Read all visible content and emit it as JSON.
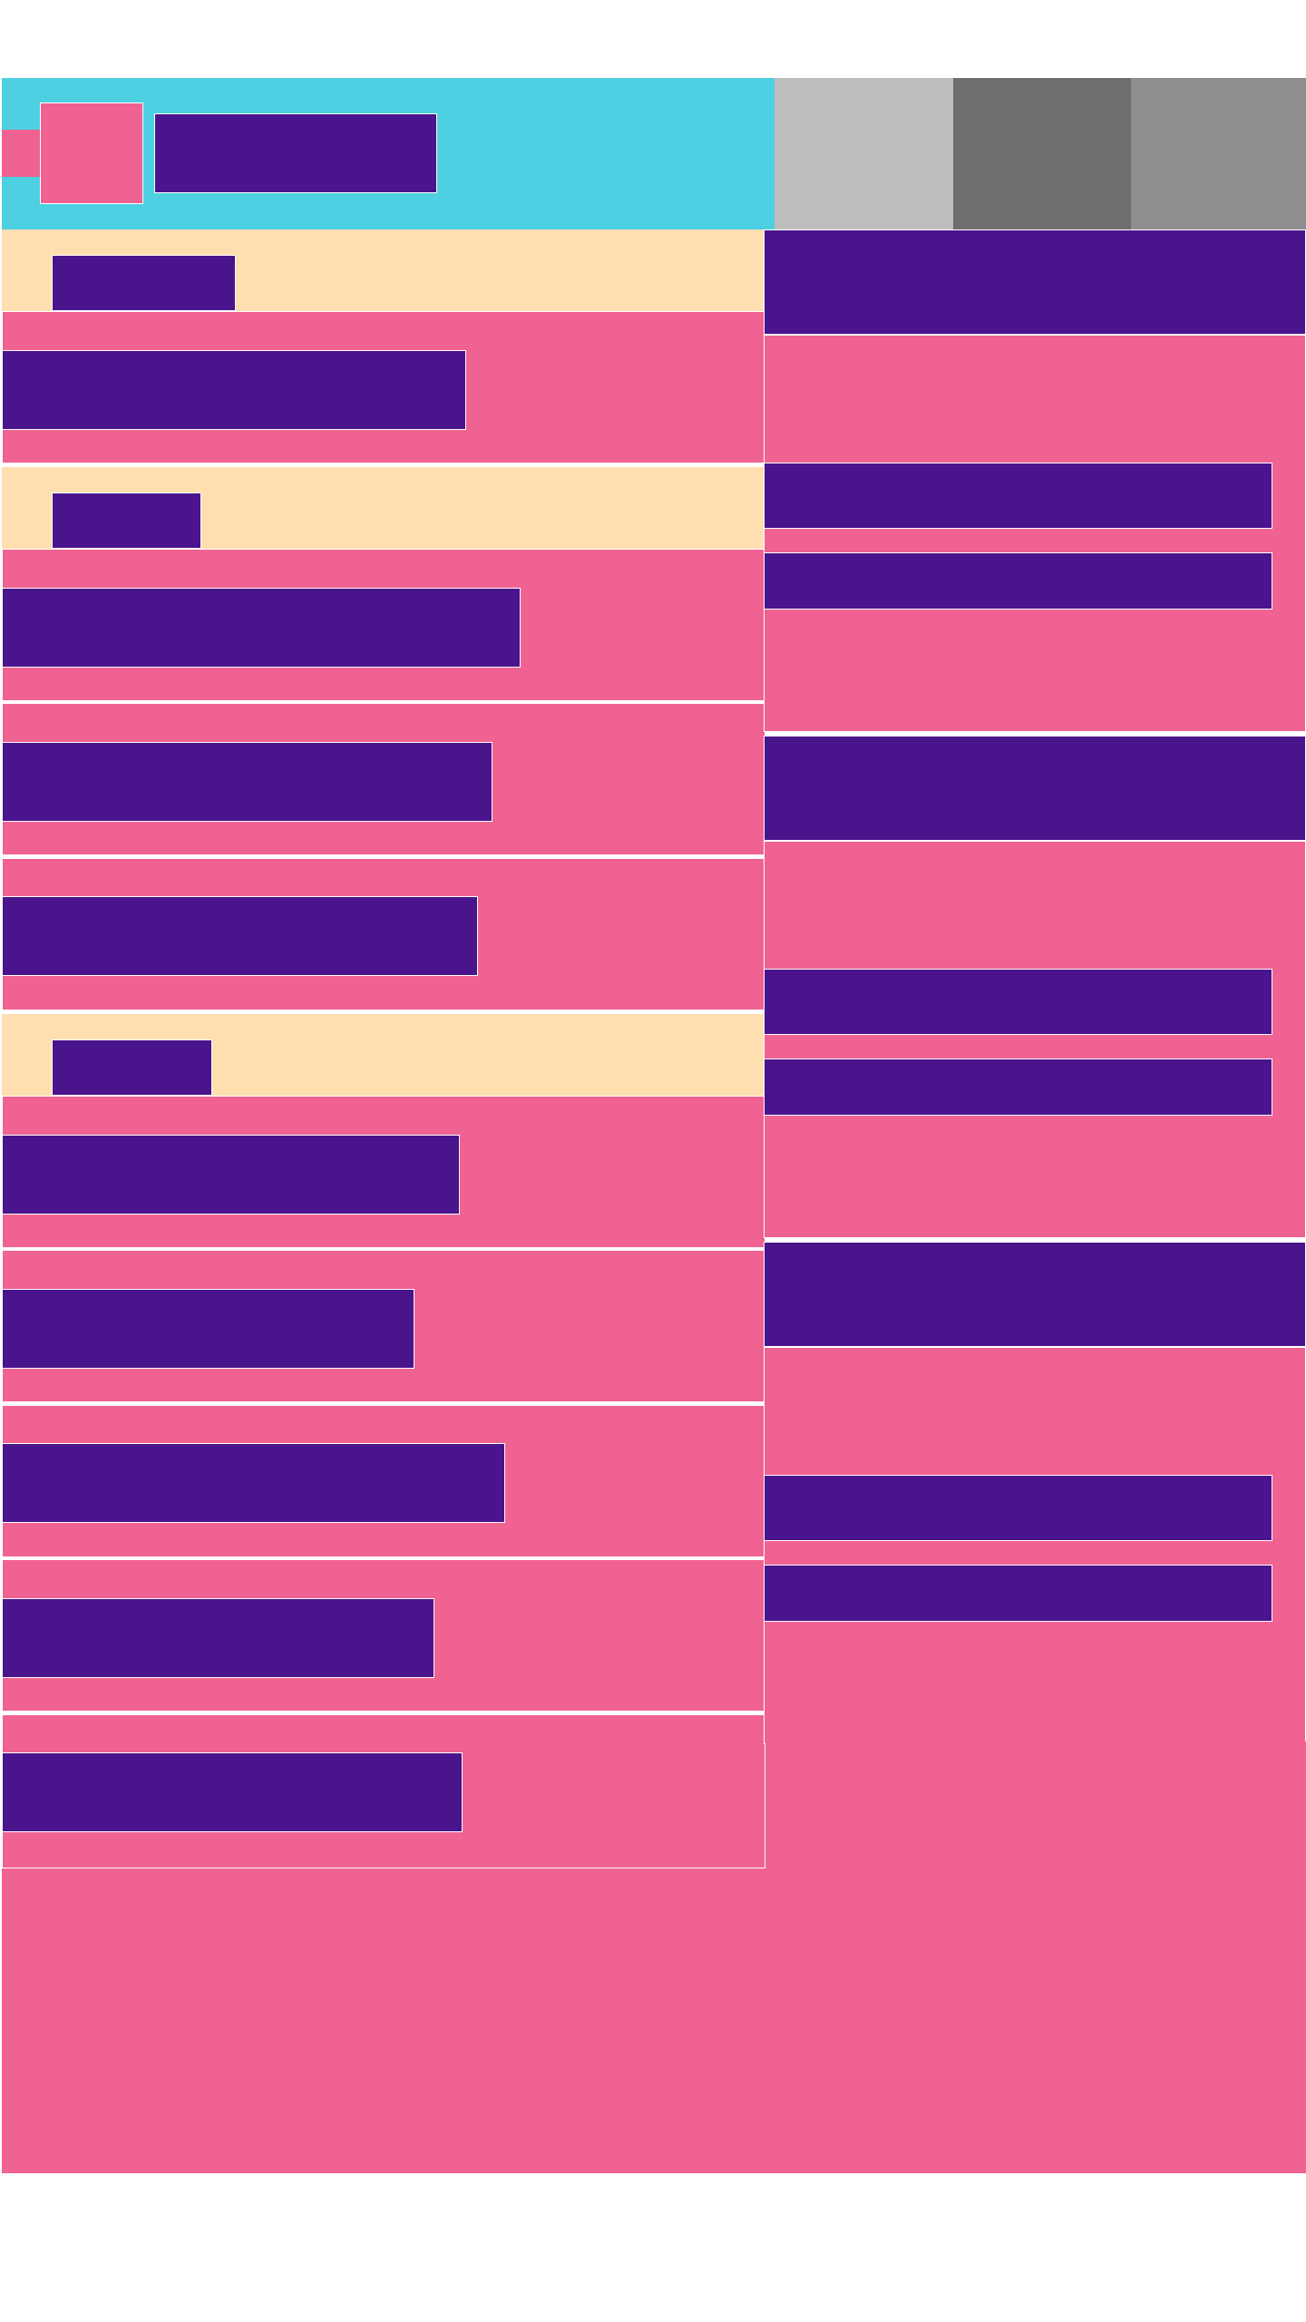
{
  "colors": {
    "header_bg": "#4dd0e1",
    "pink": "#f06292",
    "bar": "#4a148c",
    "section_bg": "#ffdeb0",
    "tab_light": "#bdbdbd",
    "tab_dark": "#6e6e6e",
    "tab_mid": "#8e8e8e"
  },
  "icons": {
    "logo": "app-logo",
    "sidebar_toggle": "menu-tab"
  },
  "header": {
    "title": ""
  },
  "tabs": [
    {
      "label": "",
      "color": "#bdbdbd"
    },
    {
      "label": "",
      "color": "#6e6e6e"
    },
    {
      "label": "",
      "color": "#8e8e8e"
    }
  ],
  "list": {
    "sections": [
      {
        "label": ""
      },
      {
        "label": ""
      },
      {
        "label": ""
      }
    ],
    "items": [
      {
        "label": ""
      },
      {
        "label": ""
      },
      {
        "label": ""
      },
      {
        "label": ""
      },
      {
        "label": ""
      },
      {
        "label": ""
      },
      {
        "label": ""
      },
      {
        "label": ""
      },
      {
        "label": ""
      }
    ]
  },
  "panels": [
    {
      "title": "",
      "lines": [
        "",
        ""
      ]
    },
    {
      "title": "",
      "lines": [
        "",
        ""
      ]
    },
    {
      "title": "",
      "lines": [
        "",
        ""
      ]
    }
  ]
}
